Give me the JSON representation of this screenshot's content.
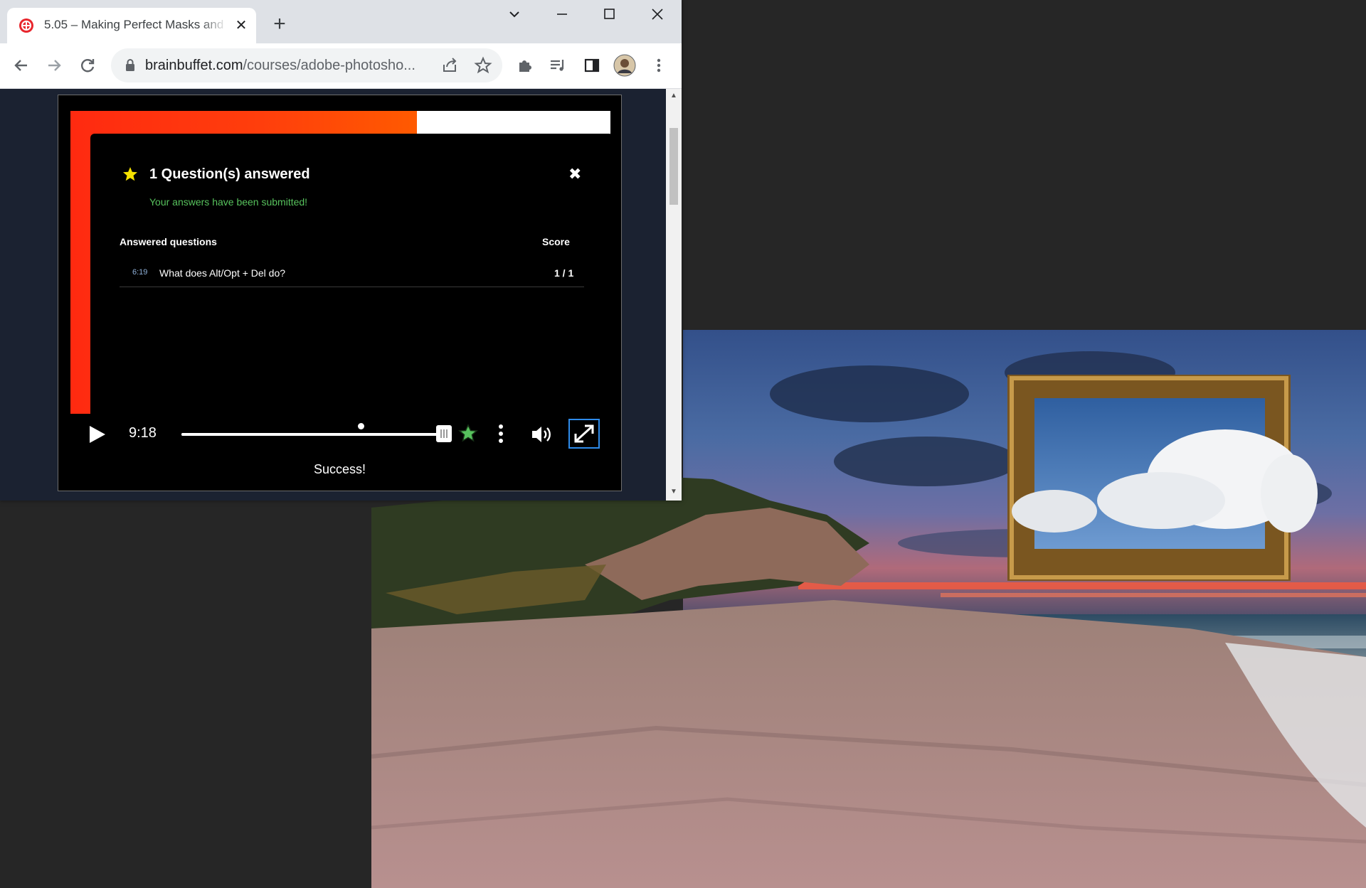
{
  "browser": {
    "tab_title": "5.05 – Making Perfect Masks and",
    "new_tab_label": "+",
    "url_host": "brainbuffet.com",
    "url_path": "/courses/adobe-photosho...",
    "colors": {
      "tab_strip": "#dee1e6",
      "toolbar": "#ffffff",
      "favicon": "#e8262d"
    }
  },
  "player": {
    "time": "9:18",
    "progress_fraction": 1.0,
    "status": "Success!",
    "colors": {
      "accent_red": "#ff2a10",
      "fullscreen_border": "#2e8bea",
      "quiz_marker": "#57c25d"
    }
  },
  "quiz": {
    "title": "1 Question(s) answered",
    "subtitle": "Your answers have been submitted!",
    "col_questions": "Answered questions",
    "col_score": "Score",
    "rows": [
      {
        "time": "6:19",
        "question": "What does Alt/Opt + Del do?",
        "score": "1 / 1"
      }
    ],
    "colors": {
      "star": "#f5e100",
      "subtitle": "#57c25d"
    }
  },
  "icons": [
    "back-icon",
    "forward-icon",
    "reload-icon",
    "lock-icon",
    "share-icon",
    "star-icon",
    "extensions-icon",
    "reading-list-icon",
    "side-panel-icon",
    "avatar",
    "menu-icon",
    "play-icon",
    "more-icon",
    "volume-icon",
    "fullscreen-icon"
  ]
}
